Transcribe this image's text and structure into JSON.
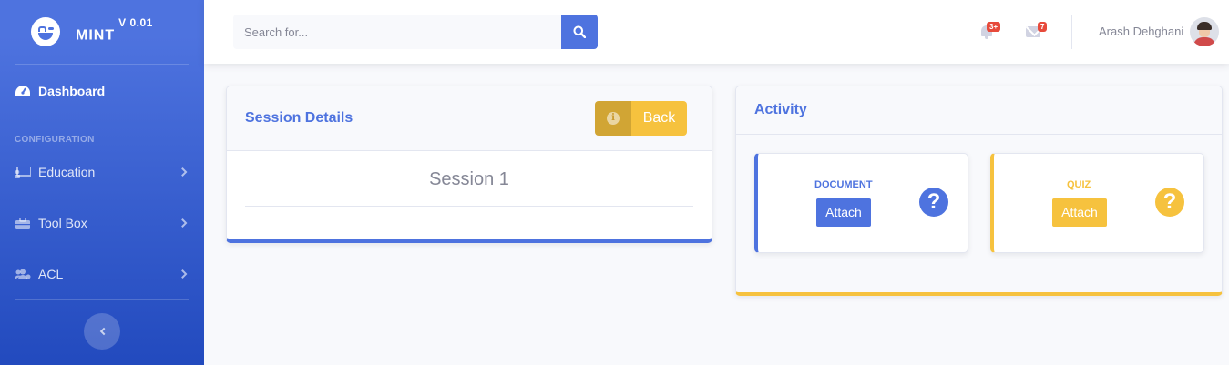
{
  "brand": {
    "name": "MINT",
    "version": "V 0.01"
  },
  "sidebar": {
    "dashboard_label": "Dashboard",
    "heading": "CONFIGURATION",
    "items": [
      {
        "label": "Education",
        "icon": "chalkboard-icon"
      },
      {
        "label": "Tool Box",
        "icon": "toolbox-icon"
      },
      {
        "label": "ACL",
        "icon": "users-cog-icon"
      }
    ]
  },
  "topbar": {
    "search_placeholder": "Search for...",
    "alerts_badge": "3+",
    "messages_badge": "7",
    "user_name": "Arash Dehghani"
  },
  "session_card": {
    "title": "Session Details",
    "back_label": "Back",
    "session_name": "Session 1"
  },
  "activity_card": {
    "title": "Activity",
    "items": [
      {
        "label": "DOCUMENT",
        "button": "Attach",
        "color": "#4e73df"
      },
      {
        "label": "QUIZ",
        "button": "Attach",
        "color": "#f6c23e"
      }
    ]
  },
  "colors": {
    "primary": "#4e73df",
    "warning": "#f6c23e",
    "danger": "#e74a3b"
  }
}
